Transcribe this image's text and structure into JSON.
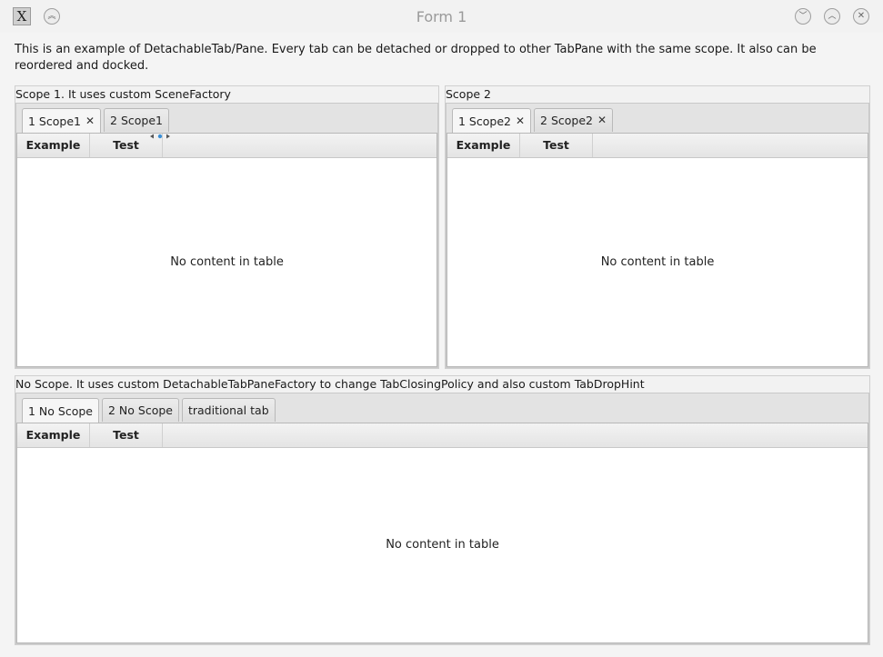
{
  "window": {
    "title": "Form 1",
    "app_icon": "X",
    "app_icon_name": "x-app-icon",
    "controls": [
      "minimize",
      "maximize",
      "close"
    ]
  },
  "intro_text": "This is an example of DetachableTab/Pane. Every tab can be detached or dropped to other TabPane with the same scope. It also can be reordered and docked.",
  "scope1": {
    "title": "Scope 1. It uses custom SceneFactory",
    "tabs": [
      {
        "label": "1 Scope1",
        "closable": true,
        "selected": true
      },
      {
        "label": "2 Scope1",
        "closable": false,
        "selected": false
      }
    ],
    "columns": [
      "Example",
      "Test"
    ],
    "empty_text": "No content in table"
  },
  "scope2": {
    "title": "Scope 2",
    "tabs": [
      {
        "label": "1 Scope2",
        "closable": true,
        "selected": true
      },
      {
        "label": "2 Scope2",
        "closable": true,
        "selected": false
      }
    ],
    "columns": [
      "Example",
      "Test"
    ],
    "empty_text": "No content in table"
  },
  "noscope": {
    "title": "No Scope. It uses custom DetachableTabPaneFactory to change TabClosingPolicy and also custom TabDropHint",
    "tabs": [
      {
        "label": "1 No Scope",
        "selected": true
      },
      {
        "label": "2 No Scope",
        "selected": false
      },
      {
        "label": "traditional tab",
        "selected": false
      }
    ],
    "columns": [
      "Example",
      "Test"
    ],
    "empty_text": "No content in table"
  },
  "close_glyph": "✕",
  "colors": {
    "accent_hint": "#3a8fd6"
  }
}
